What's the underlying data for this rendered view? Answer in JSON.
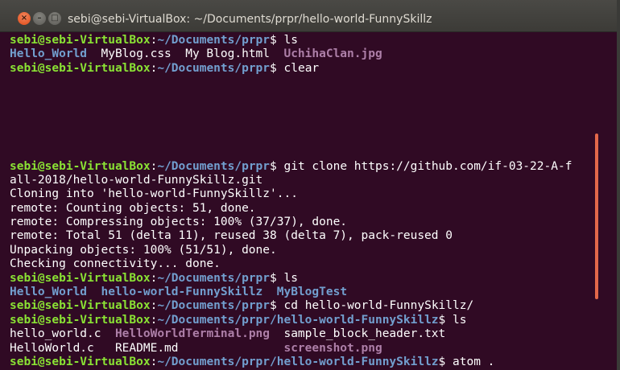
{
  "window": {
    "title": "sebi@sebi-VirtualBox: ~/Documents/prpr/hello-world-FunnySkillz",
    "close_glyph": "×",
    "minimize_glyph": "–",
    "maximize_glyph": "□"
  },
  "colors": {
    "background": "#300a24",
    "user": "#8ae234",
    "path": "#729fcf",
    "directory": "#729fcf",
    "image_file": "#ad7fa8",
    "text": "#ffffff",
    "scrollbar": "#e3684a"
  },
  "terminal": {
    "lines": [
      {
        "user": "sebi@sebi-VirtualBox",
        "path": "~/Documents/prpr",
        "command": "ls"
      },
      {
        "items": [
          {
            "text": "Hello_World",
            "kind": "dir"
          },
          {
            "text": "  MyBlog.css  My Blog.html  ",
            "kind": "plain"
          },
          {
            "text": "UchihaClan.jpg",
            "kind": "img"
          }
        ]
      },
      {
        "user": "sebi@sebi-VirtualBox",
        "path": "~/Documents/prpr",
        "command": "clear"
      },
      {
        "text": ""
      },
      {
        "text": ""
      },
      {
        "text": ""
      },
      {
        "text": ""
      },
      {
        "text": ""
      },
      {
        "text": ""
      },
      {
        "user": "sebi@sebi-VirtualBox",
        "path": "~/Documents/prpr",
        "command": "git clone https://github.com/if-03-22-A-f"
      },
      {
        "text": "all-2018/hello-world-FunnySkillz.git"
      },
      {
        "text": "Cloning into 'hello-world-FunnySkillz'..."
      },
      {
        "text": "remote: Counting objects: 51, done."
      },
      {
        "text": "remote: Compressing objects: 100% (37/37), done."
      },
      {
        "text": "remote: Total 51 (delta 11), reused 38 (delta 7), pack-reused 0"
      },
      {
        "text": "Unpacking objects: 100% (51/51), done."
      },
      {
        "text": "Checking connectivity... done."
      },
      {
        "user": "sebi@sebi-VirtualBox",
        "path": "~/Documents/prpr",
        "command": "ls"
      },
      {
        "items": [
          {
            "text": "Hello_World",
            "kind": "dir"
          },
          {
            "text": "  ",
            "kind": "plain"
          },
          {
            "text": "hello-world-FunnySkillz",
            "kind": "dir"
          },
          {
            "text": "  ",
            "kind": "plain"
          },
          {
            "text": "MyBlogTest",
            "kind": "dir"
          }
        ]
      },
      {
        "user": "sebi@sebi-VirtualBox",
        "path": "~/Documents/prpr",
        "command": "cd hello-world-FunnySkillz/"
      },
      {
        "user": "sebi@sebi-VirtualBox",
        "path": "~/Documents/prpr/hello-world-FunnySkillz",
        "command": "ls"
      },
      {
        "items": [
          {
            "text": "hello_world.c  ",
            "kind": "plain"
          },
          {
            "text": "HelloWorldTerminal.png",
            "kind": "img"
          },
          {
            "text": "  sample_block_header.txt",
            "kind": "plain"
          }
        ]
      },
      {
        "items": [
          {
            "text": "HelloWorld.c   README.md               ",
            "kind": "plain"
          },
          {
            "text": "screenshot.png",
            "kind": "img"
          }
        ]
      },
      {
        "user": "sebi@sebi-VirtualBox",
        "path": "~/Documents/prpr/hello-world-FunnySkillz",
        "command": "atom ."
      }
    ]
  }
}
